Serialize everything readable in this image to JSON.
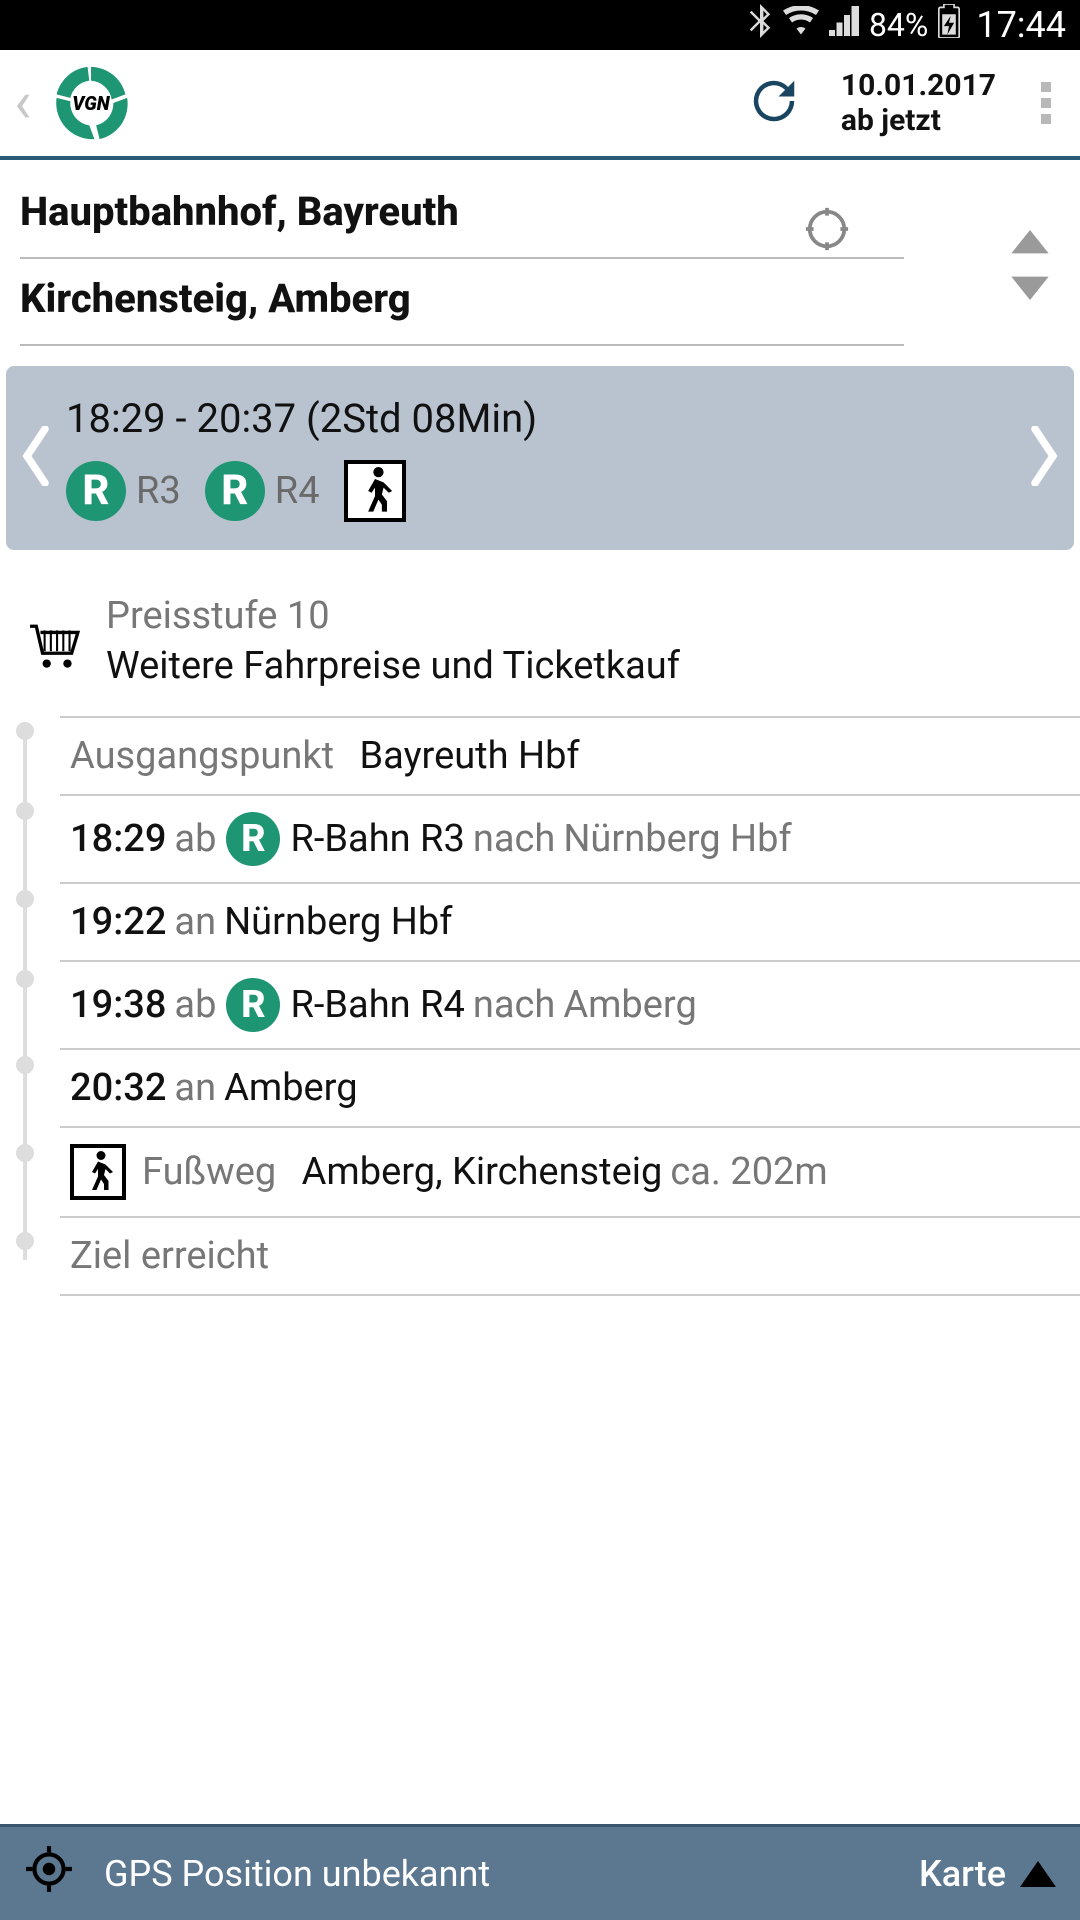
{
  "status": {
    "battery": "84%",
    "clock": "17:44"
  },
  "header": {
    "date": "10.01.2017",
    "sub": "ab jetzt"
  },
  "od": {
    "from": "Hauptbahnhof, Bayreuth",
    "to": "Kirchensteig, Amberg"
  },
  "summary": {
    "time": "18:29 - 20:37 (2Std 08Min)",
    "legs": [
      {
        "badge": "R",
        "label": "R3"
      },
      {
        "badge": "R",
        "label": "R4"
      }
    ]
  },
  "price": {
    "line1": "Preisstufe 10",
    "line2": "Weitere Fahrpreise und Ticketkauf"
  },
  "journey": {
    "start_label": "Ausgangspunkt",
    "start_station": "Bayreuth Hbf",
    "steps": [
      {
        "time": "18:29",
        "dir": "ab",
        "line": "R-Bahn R3",
        "nach": "nach",
        "dest": "Nürnberg Hbf",
        "badge": true
      },
      {
        "time": "19:22",
        "dir": "an",
        "dest": "Nürnberg Hbf"
      },
      {
        "time": "19:38",
        "dir": "ab",
        "line": "R-Bahn R4",
        "nach": "nach",
        "dest": "Amberg",
        "badge": true
      },
      {
        "time": "20:32",
        "dir": "an",
        "dest": "Amberg"
      }
    ],
    "walk": {
      "label": "Fußweg",
      "dest": "Amberg, Kirchensteig",
      "dist": "ca. 202m"
    },
    "end": "Ziel erreicht"
  },
  "bottom": {
    "gps": "GPS Position unbekannt",
    "map": "Karte"
  }
}
